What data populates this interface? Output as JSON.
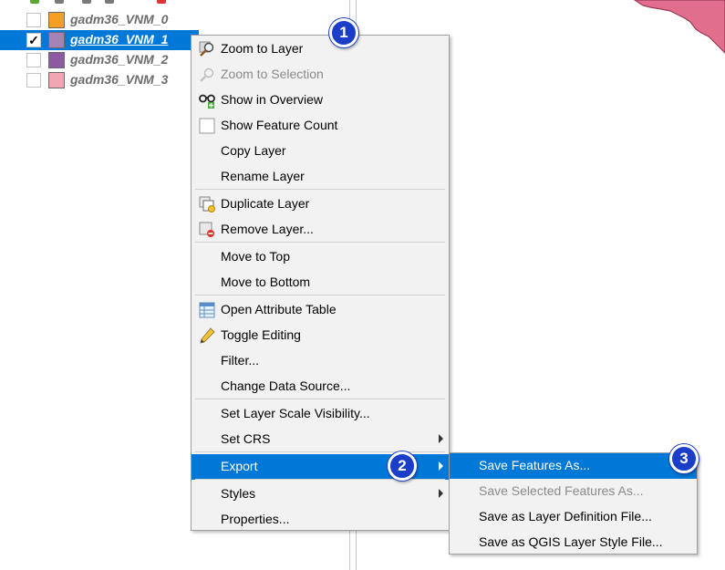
{
  "layers_panel": {
    "layers": [
      {
        "name": "gadm36_VNM_0",
        "checked": false,
        "swatch_color": "#f5a023"
      },
      {
        "name": "gadm36_VNM_1",
        "checked": true,
        "selected": true,
        "swatch_color": "#a783b5",
        "check_mark": "✓"
      },
      {
        "name": "gadm36_VNM_2",
        "checked": false,
        "swatch_color": "#8b5aa0"
      },
      {
        "name": "gadm36_VNM_3",
        "checked": false,
        "swatch_color": "#f0a7b3"
      }
    ]
  },
  "map": {
    "feature_fill": "#e26e8d",
    "feature_stroke": "#9b3a55"
  },
  "context_menu": {
    "items": [
      {
        "label": "Zoom to Layer",
        "icon": "zoom-layer-icon"
      },
      {
        "label": "Zoom to Selection",
        "icon": "zoom-selection-icon",
        "disabled": true
      },
      {
        "label": "Show in Overview",
        "icon": "overview-icon"
      },
      {
        "label": "Show Feature Count",
        "icon": "checkbox-icon"
      },
      {
        "label": "Copy Layer"
      },
      {
        "label": "Rename Layer"
      },
      {
        "label": "Duplicate Layer",
        "icon": "duplicate-icon"
      },
      {
        "label": "Remove Layer...",
        "icon": "remove-icon"
      },
      {
        "label": "Move to Top"
      },
      {
        "label": "Move to Bottom"
      },
      {
        "label": "Open Attribute Table",
        "icon": "table-icon"
      },
      {
        "label": "Toggle Editing",
        "icon": "pencil-icon"
      },
      {
        "label": "Filter..."
      },
      {
        "label": "Change Data Source..."
      },
      {
        "label": "Set Layer Scale Visibility..."
      },
      {
        "label": "Set CRS",
        "submenu": true
      },
      {
        "label": "Export",
        "submenu": true,
        "highlighted": true
      },
      {
        "label": "Styles",
        "submenu": true
      },
      {
        "label": "Properties..."
      }
    ]
  },
  "export_submenu": {
    "items": [
      {
        "label": "Save Features As...",
        "highlighted": true
      },
      {
        "label": "Save Selected Features As...",
        "disabled": true
      },
      {
        "label": "Save as Layer Definition File..."
      },
      {
        "label": "Save as QGIS Layer Style File..."
      }
    ]
  },
  "step_badges": [
    "1",
    "2",
    "3"
  ],
  "colors": {
    "selection": "#0078d7",
    "badge": "#1a3ec8",
    "menu_bg": "#f2f2f2"
  }
}
